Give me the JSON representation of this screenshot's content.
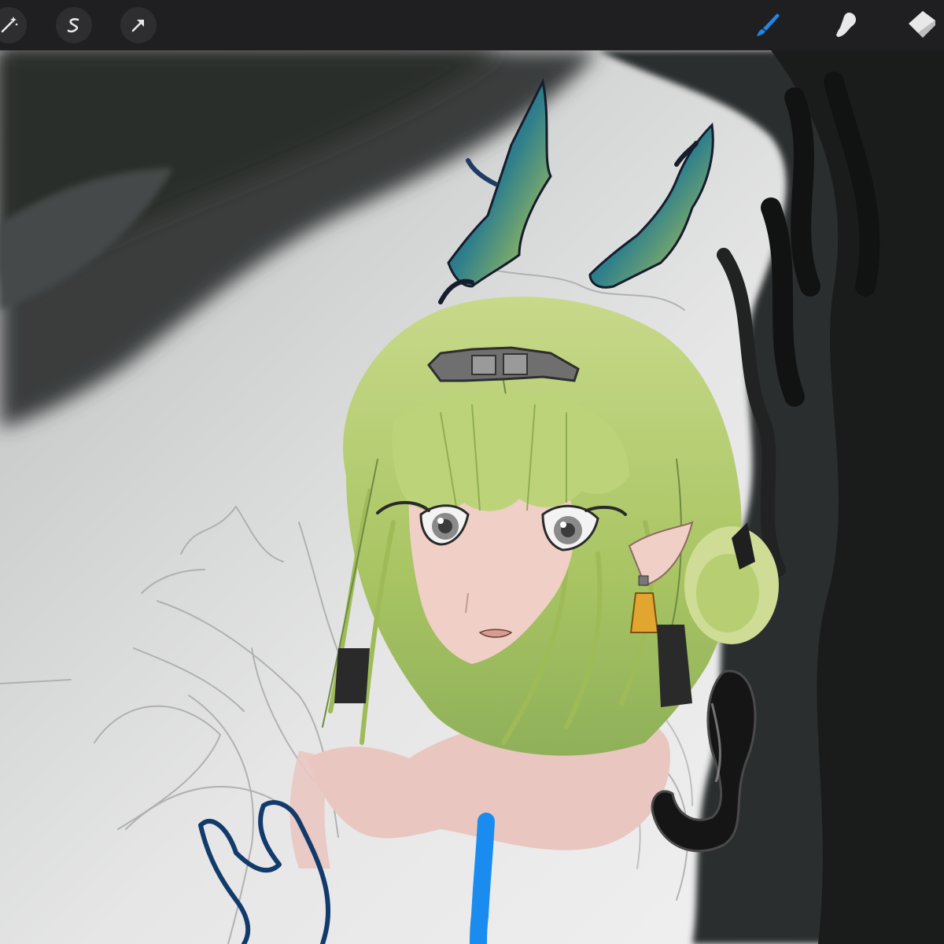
{
  "app": "drawing-canvas",
  "toolbar": {
    "left_tools": [
      {
        "name": "adjustments",
        "icon": "magic-wand-icon"
      },
      {
        "name": "selection",
        "icon": "selection-s-icon"
      },
      {
        "name": "transform",
        "icon": "transform-arrow-icon"
      }
    ],
    "right_tools": [
      {
        "name": "paint",
        "icon": "brush-icon",
        "active": true
      },
      {
        "name": "smudge",
        "icon": "smudge-finger-icon",
        "active": false
      },
      {
        "name": "erase",
        "icon": "eraser-icon",
        "active": false
      }
    ]
  },
  "colors": {
    "toolbar_bg": "#1f1f21",
    "button_bg": "#2e2e31",
    "icon_idle": "#e8e8e8",
    "active_tool": "#1e88e5",
    "hair": "#b7cf72",
    "skin": "#e9c7c0",
    "lineart_blue": "#123a6b",
    "stroke_blue": "#1a8cf0"
  }
}
